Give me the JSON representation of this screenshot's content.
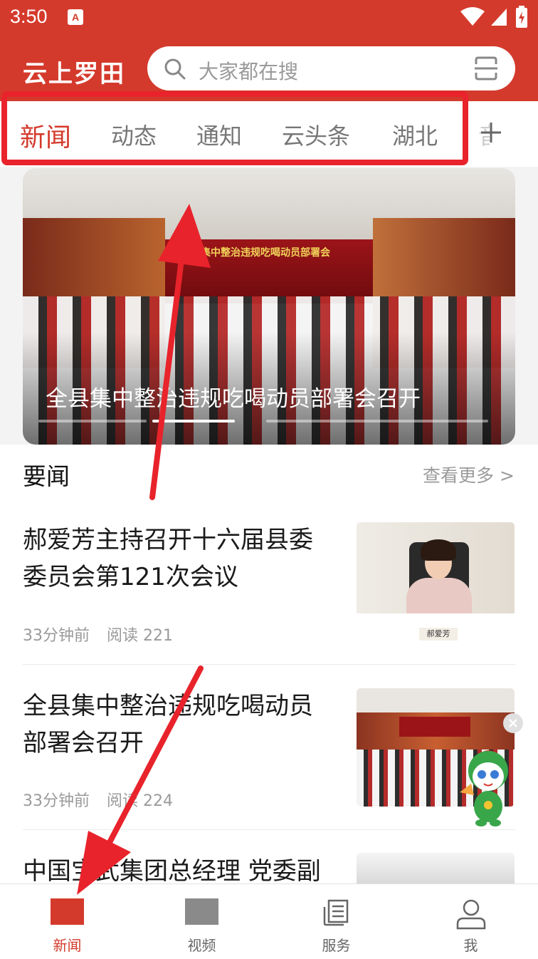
{
  "status_bar": {
    "time": "3:50",
    "notif_letter": "A"
  },
  "header": {
    "brand": "云上罗田",
    "search_placeholder": "大家都在搜"
  },
  "tabs": [
    {
      "label": "新闻",
      "active": true
    },
    {
      "label": "动态",
      "active": false
    },
    {
      "label": "通知",
      "active": false
    },
    {
      "label": "云头条",
      "active": false
    },
    {
      "label": "湖北",
      "active": false
    }
  ],
  "tab_partial": "音",
  "banner": {
    "caption": "全县集中整治违规吃喝动员部署会召开",
    "stage_text": "集中整治违规吃喝动员部署会",
    "active_index": 1,
    "count": 4
  },
  "section": {
    "title": "要闻",
    "see_more": "查看更多 >"
  },
  "news": [
    {
      "title": "郝爱芳主持召开十六届县委委员会第121次会议",
      "time": "33分钟前",
      "reads": "阅读 221",
      "nameplate": "郝爱芳"
    },
    {
      "title": "全县集中整治违规吃喝动员部署会召开",
      "time": "33分钟前",
      "reads": "阅读 224"
    },
    {
      "title": "中国宝武集团总经理 党委副"
    }
  ],
  "bottom_nav": [
    {
      "label": "新闻",
      "icon": "news-icon",
      "active": true
    },
    {
      "label": "视频",
      "icon": "video-icon",
      "active": false
    },
    {
      "label": "服务",
      "icon": "service-icon",
      "active": false
    },
    {
      "label": "我",
      "icon": "profile-icon",
      "active": false
    }
  ],
  "colors": {
    "brand_red": "#d43a2c",
    "annotation_red": "#e8232b"
  }
}
